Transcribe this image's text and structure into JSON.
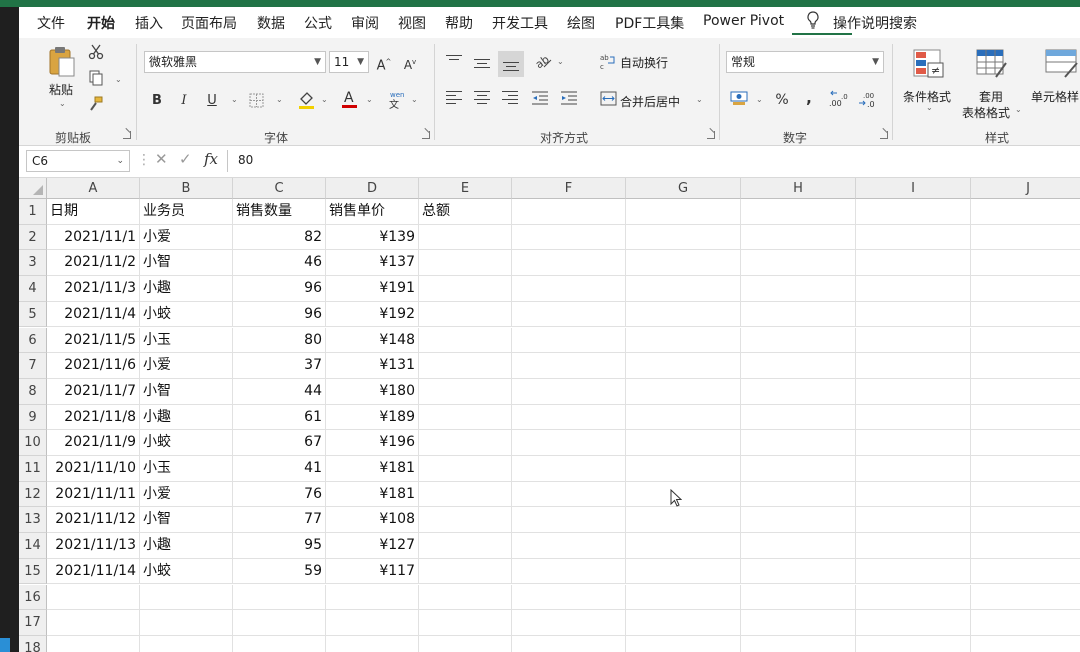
{
  "menu": {
    "tabs": [
      "文件",
      "开始",
      "插入",
      "页面布局",
      "数据",
      "公式",
      "审阅",
      "视图",
      "帮助",
      "开发工具",
      "绘图",
      "PDF工具集",
      "Power Pivot",
      "操作说明搜索"
    ],
    "active": "开始"
  },
  "ribbon": {
    "clipboard": {
      "paste_label": "粘贴",
      "group_label": "剪贴板"
    },
    "font": {
      "name": "微软雅黑",
      "size": "11",
      "bold": "B",
      "italic": "I",
      "underline": "U",
      "grow": "A",
      "shrink": "A",
      "group_label": "字体"
    },
    "alignment": {
      "wrap_label": "自动换行",
      "merge_label": "合并后居中",
      "group_label": "对齐方式"
    },
    "number": {
      "format": "常规",
      "percent": "%",
      "comma": ",",
      "group_label": "数字"
    },
    "styles": {
      "conditional_label": "条件格式",
      "table_label_1": "套用",
      "table_label_2": "表格格式",
      "cell_label": "单元格样",
      "group_label": "样式"
    }
  },
  "formula_bar": {
    "name_box": "C6",
    "formula": "80",
    "fx": "fx"
  },
  "grid": {
    "columns": [
      "A",
      "B",
      "C",
      "D",
      "E",
      "F",
      "G",
      "H",
      "I",
      "J"
    ],
    "row_numbers": [
      "1",
      "2",
      "3",
      "4",
      "5",
      "6",
      "7",
      "8",
      "9",
      "10",
      "11",
      "12",
      "13",
      "14",
      "15",
      "16",
      "17",
      "18"
    ],
    "header": [
      "日期",
      "业务员",
      "销售数量",
      "销售单价",
      "总额"
    ],
    "rows": [
      [
        "2021/11/1",
        "小爱",
        "82",
        "¥139"
      ],
      [
        "2021/11/2",
        "小智",
        "46",
        "¥137"
      ],
      [
        "2021/11/3",
        "小趣",
        "96",
        "¥191"
      ],
      [
        "2021/11/4",
        "小蛟",
        "96",
        "¥192"
      ],
      [
        "2021/11/5",
        "小玉",
        "80",
        "¥148"
      ],
      [
        "2021/11/6",
        "小爱",
        "37",
        "¥131"
      ],
      [
        "2021/11/7",
        "小智",
        "44",
        "¥180"
      ],
      [
        "2021/11/8",
        "小趣",
        "61",
        "¥189"
      ],
      [
        "2021/11/9",
        "小蛟",
        "67",
        "¥196"
      ],
      [
        "2021/11/10",
        "小玉",
        "41",
        "¥181"
      ],
      [
        "2021/11/11",
        "小爱",
        "76",
        "¥181"
      ],
      [
        "2021/11/12",
        "小智",
        "77",
        "¥108"
      ],
      [
        "2021/11/13",
        "小趣",
        "95",
        "¥127"
      ],
      [
        "2021/11/14",
        "小蛟",
        "59",
        "¥117"
      ]
    ]
  },
  "colors": {
    "accent": "#217346",
    "header_bg": "#efefef"
  }
}
